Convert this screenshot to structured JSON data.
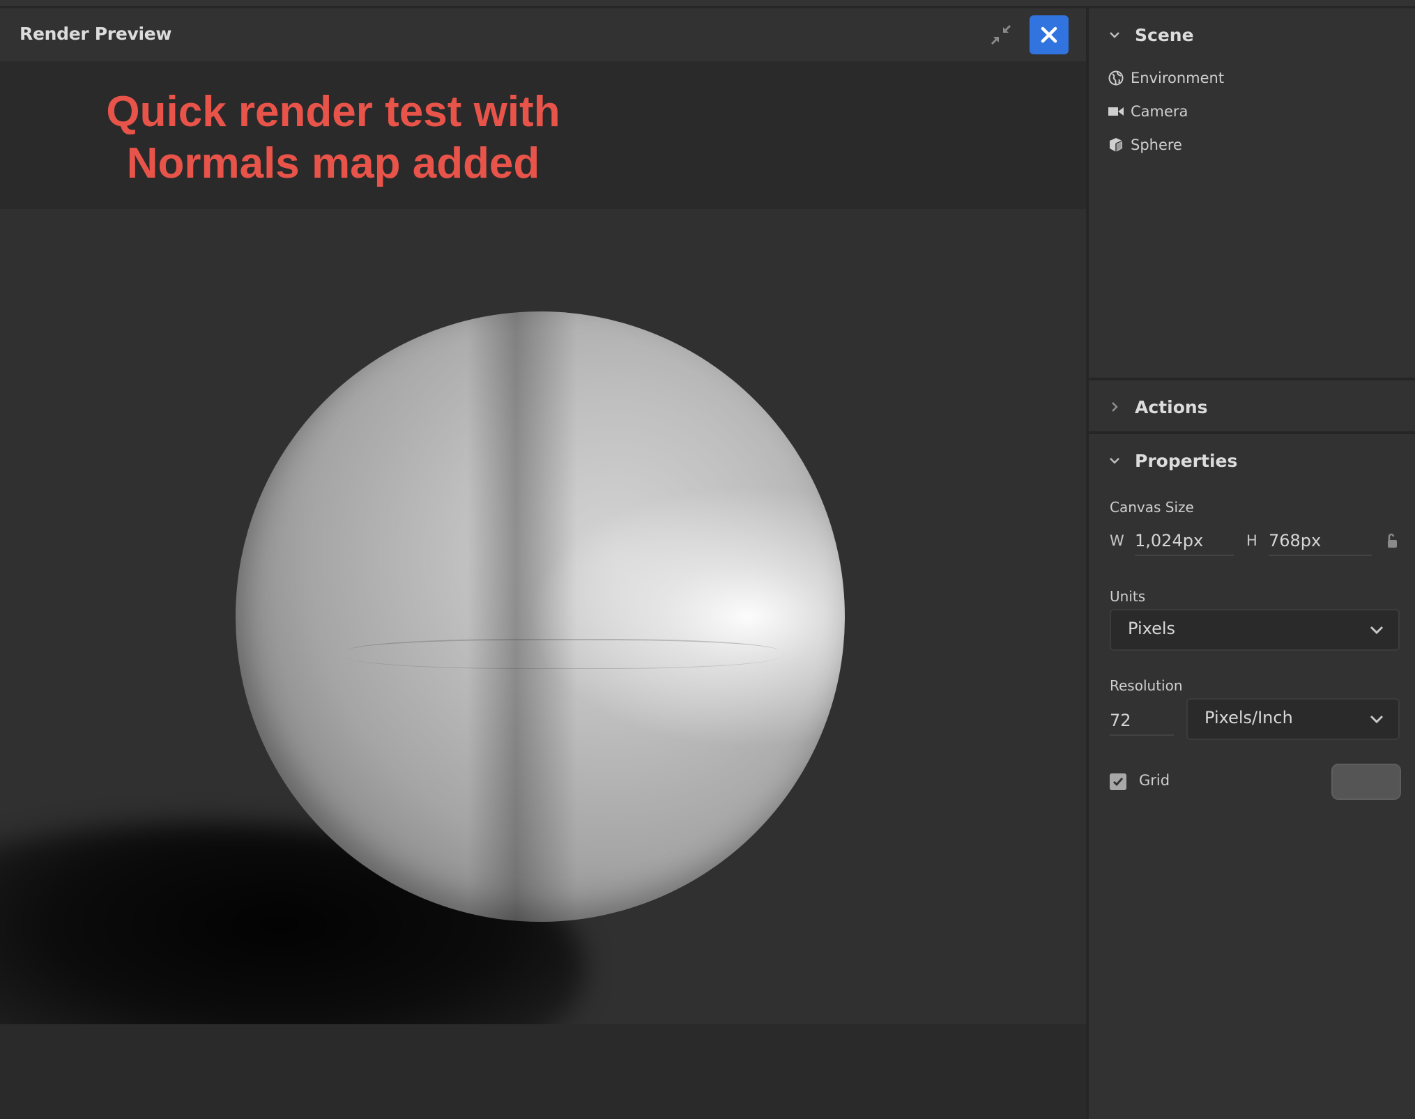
{
  "preview": {
    "title": "Render Preview",
    "collapse_icon": "collapse-arrows-icon",
    "close_icon": "close-icon",
    "annotation_line1": "Quick render test with",
    "annotation_line2": "Normals map added",
    "annotation_color": "#e8544a",
    "close_button_color": "#3174e0"
  },
  "scene": {
    "title": "Scene",
    "expanded": true,
    "items": [
      {
        "label": "Environment",
        "icon": "globe-icon"
      },
      {
        "label": "Camera",
        "icon": "video-camera-icon"
      },
      {
        "label": "Sphere",
        "icon": "cube-icon"
      }
    ]
  },
  "actions": {
    "title": "Actions",
    "expanded": false
  },
  "properties": {
    "title": "Properties",
    "expanded": true,
    "canvas_size_label": "Canvas Size",
    "width_letter": "W",
    "width_value": "1,024px",
    "height_letter": "H",
    "height_value": "768px",
    "lock_icon": "unlocked-padlock-icon",
    "units_label": "Units",
    "units_value": "Pixels",
    "resolution_label": "Resolution",
    "resolution_value": "72",
    "resolution_unit": "Pixels/Inch",
    "grid_label": "Grid",
    "grid_checked": true,
    "grid_color": "#555555"
  }
}
